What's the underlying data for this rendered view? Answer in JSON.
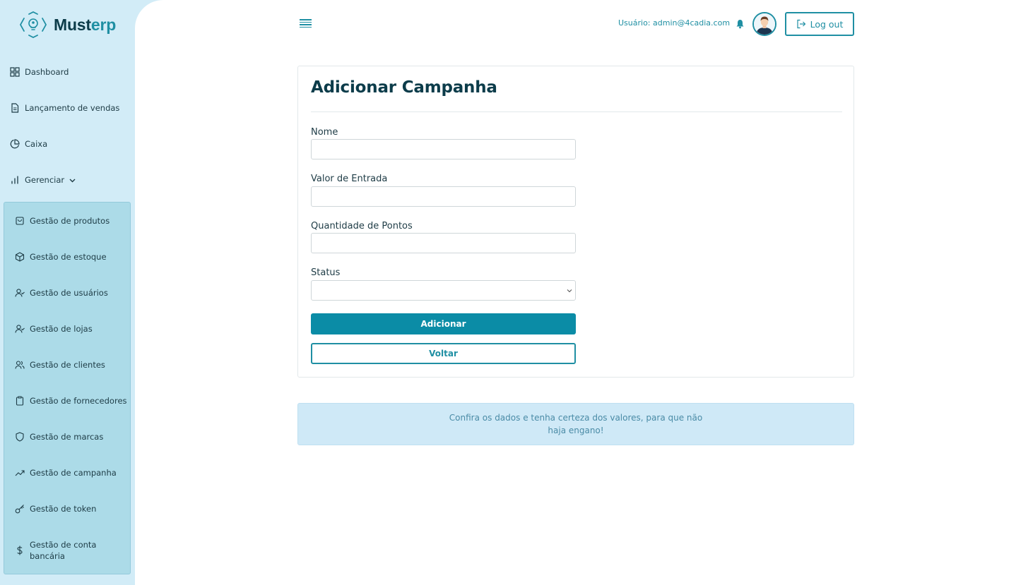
{
  "brand": {
    "name_part1": "Must",
    "name_part2": "erp",
    "primary_color": "#0b8ca6",
    "sidebar_bg": "#d2ecf7",
    "submenu_bg": "#acdbe8"
  },
  "sidebar": {
    "items": [
      {
        "label": "Dashboard",
        "icon": "grid-icon"
      },
      {
        "label": "Lançamento de vendas",
        "icon": "document-icon"
      },
      {
        "label": "Caixa",
        "icon": "pie-chart-icon"
      },
      {
        "label": "Gerenciar",
        "icon": "bar-chart-icon",
        "expanded": true
      }
    ],
    "submenu": [
      {
        "label": "Gestão de produtos",
        "icon": "shopping-bag-icon"
      },
      {
        "label": "Gestão de estoque",
        "icon": "box-icon"
      },
      {
        "label": "Gestão de usuários",
        "icon": "user-check-icon"
      },
      {
        "label": "Gestão de lojas",
        "icon": "user-check-icon"
      },
      {
        "label": "Gestão de clientes",
        "icon": "users-icon"
      },
      {
        "label": "Gestão de fornecedores",
        "icon": "clipboard-icon"
      },
      {
        "label": "Gestão de marcas",
        "icon": "shield-icon"
      },
      {
        "label": "Gestão de campanha",
        "icon": "trending-up-icon"
      },
      {
        "label": "Gestão de token",
        "icon": "key-icon"
      },
      {
        "label": "Gestão de conta bancária",
        "icon": "dollar-icon"
      }
    ]
  },
  "header": {
    "user_label": "Usuário: admin@4cadia.com",
    "logout_label": "Log out"
  },
  "form": {
    "title": "Adicionar Campanha",
    "fields": [
      {
        "label": "Nome",
        "value": ""
      },
      {
        "label": "Valor de Entrada",
        "value": ""
      },
      {
        "label": "Quantidade de Pontos",
        "value": ""
      }
    ],
    "status": {
      "label": "Status",
      "value": ""
    },
    "submit_label": "Adicionar",
    "back_label": "Voltar"
  },
  "alert": {
    "line1": "Confira os dados e tenha certeza dos valores, para que não",
    "line2": "haja engano!"
  }
}
